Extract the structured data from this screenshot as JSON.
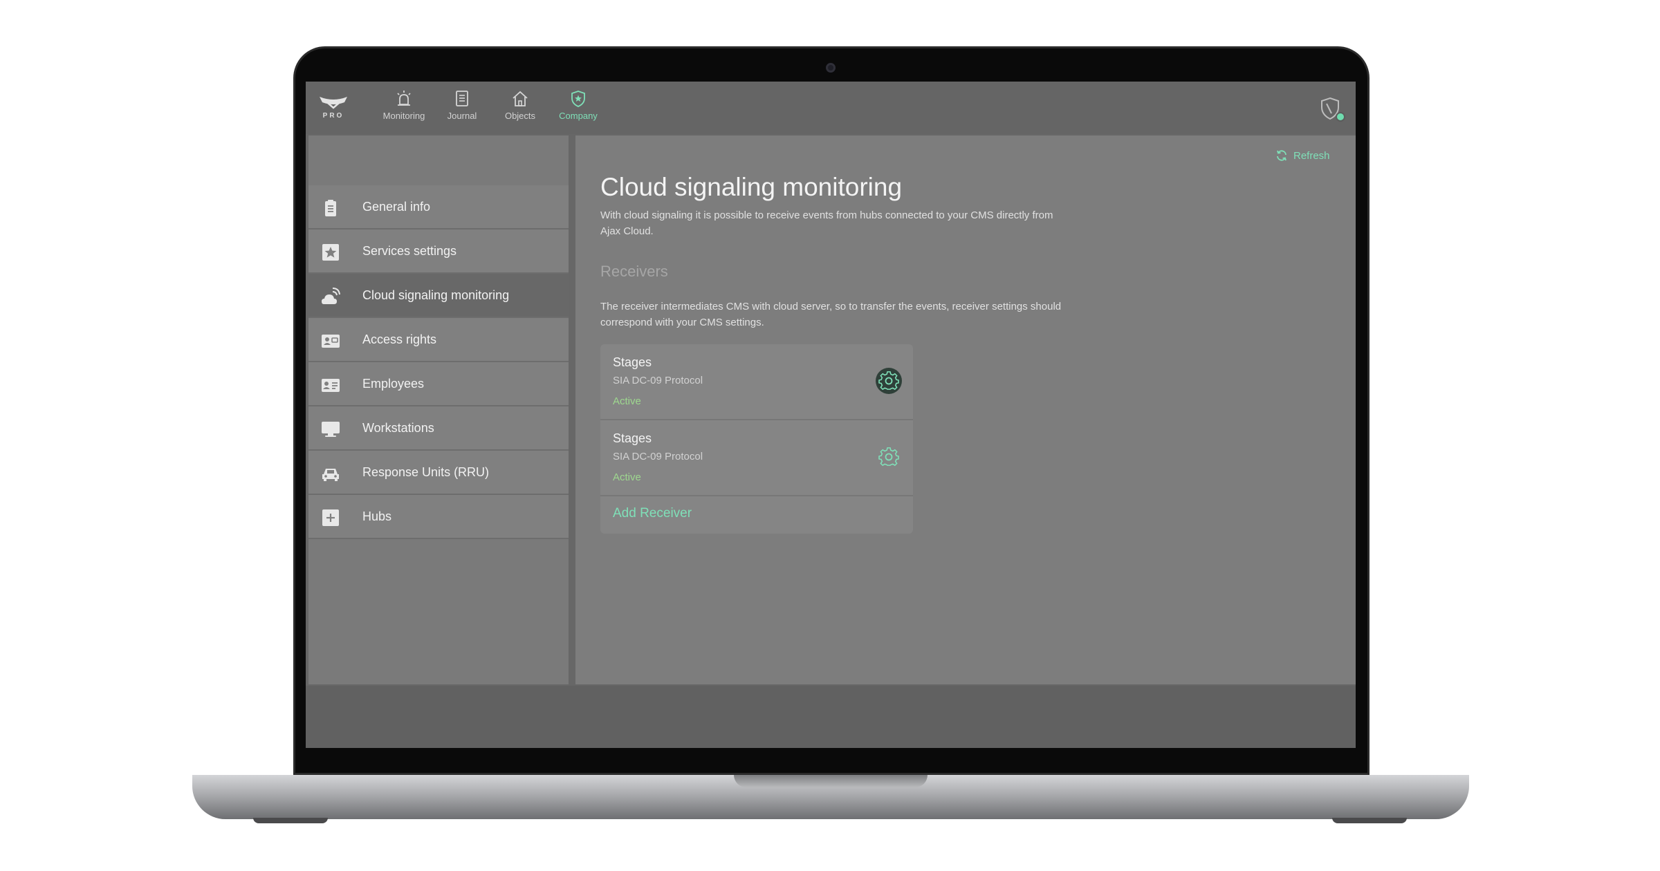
{
  "app": {
    "logo_text": "PRO"
  },
  "nav": {
    "items": [
      {
        "label": "Monitoring",
        "icon": "alarm-icon"
      },
      {
        "label": "Journal",
        "icon": "journal-icon"
      },
      {
        "label": "Objects",
        "icon": "house-icon"
      },
      {
        "label": "Company",
        "icon": "shield-star-icon",
        "active": true
      }
    ]
  },
  "sidebar": {
    "items": [
      {
        "label": "General info",
        "icon": "clipboard-icon"
      },
      {
        "label": "Services settings",
        "icon": "star-icon"
      },
      {
        "label": "Cloud signaling monitoring",
        "icon": "cloud-signal-icon",
        "active": true
      },
      {
        "label": "Access rights",
        "icon": "id-card-icon"
      },
      {
        "label": "Employees",
        "icon": "badge-icon"
      },
      {
        "label": "Workstations",
        "icon": "monitor-icon"
      },
      {
        "label": "Response Units (RRU)",
        "icon": "car-icon"
      },
      {
        "label": "Hubs",
        "icon": "plus-square-icon"
      }
    ]
  },
  "main": {
    "refresh_label": "Refresh",
    "title": "Cloud signaling monitoring",
    "description": "With cloud signaling it is possible to receive events from hubs connected to your CMS directly from Ajax Cloud.",
    "receivers_title": "Receivers",
    "receivers_description": "The receiver intermediates CMS with cloud server, so to transfer the events, receiver settings should correspond with your CMS settings.",
    "receivers": [
      {
        "name": "Stages",
        "protocol": "SIA DC-09 Protocol",
        "status": "Active"
      },
      {
        "name": "Stages",
        "protocol": "SIA DC-09 Protocol",
        "status": "Active"
      }
    ],
    "add_receiver_label": "Add Receiver"
  },
  "colors": {
    "accent": "#7fe0b8",
    "status_active": "#9ed88f",
    "sidebar_bg": "#7a7a7a",
    "main_bg": "#7d7d7d"
  }
}
